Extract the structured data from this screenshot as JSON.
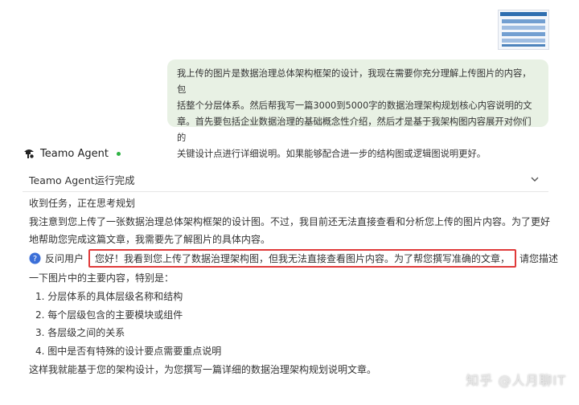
{
  "user_message": {
    "lines": [
      "我上传的图片是数据治理总体架构框架的设计，我现在需要你充分理解上传图片的内容，包",
      "括整个分层体系。然后帮我写一篇3000到5000字的数据治理架构规划核心内容说明的文",
      "章。首先要包括企业数据治理的基础概念性介绍，然后才是基于我架构图内容展开对你们的",
      "关键设计点进行详细说明。如果能够配合进一步的结构图或逻辑图说明更好。"
    ]
  },
  "agent": {
    "name": "Teamo Agent",
    "status": "Teamo Agent运行完成",
    "status_color": "#2fb344"
  },
  "response": {
    "task_received": "收到任务，正在思考规划",
    "para1_line1": "我注意到您上传了一张数据治理总体架构框架的设计图。不过，我目前还无法直接查看和分析您上传的图片内容。为了更好",
    "para1_line2": "地帮助您完成这篇文章，我需要先了解图片的具体内容。",
    "ask_label": "反问用户",
    "highlighted": "您好！我看到您上传了数据治理架构图，但我无法直接查看图片内容。为了帮您撰写准确的文章，",
    "ask_tail": "请您描述",
    "ask_line2": "一下图片中的主要内容，特别是：",
    "items": [
      "1. 分层体系的具体层级名称和结构",
      "2. 每个层级包含的主要模块或组件",
      "3. 各层级之间的关系",
      "4. 图中是否有特殊的设计要点需要重点说明"
    ],
    "closing": "这样我就能基于您的架构设计，为您撰写一篇详细的数据治理架构规划说明文章。"
  },
  "watermark": "知乎 @人月聊IT",
  "colors": {
    "bubble_bg": "#e8f1e4",
    "highlight_border": "#e03a3a",
    "question_icon": "#3b6fd8"
  }
}
